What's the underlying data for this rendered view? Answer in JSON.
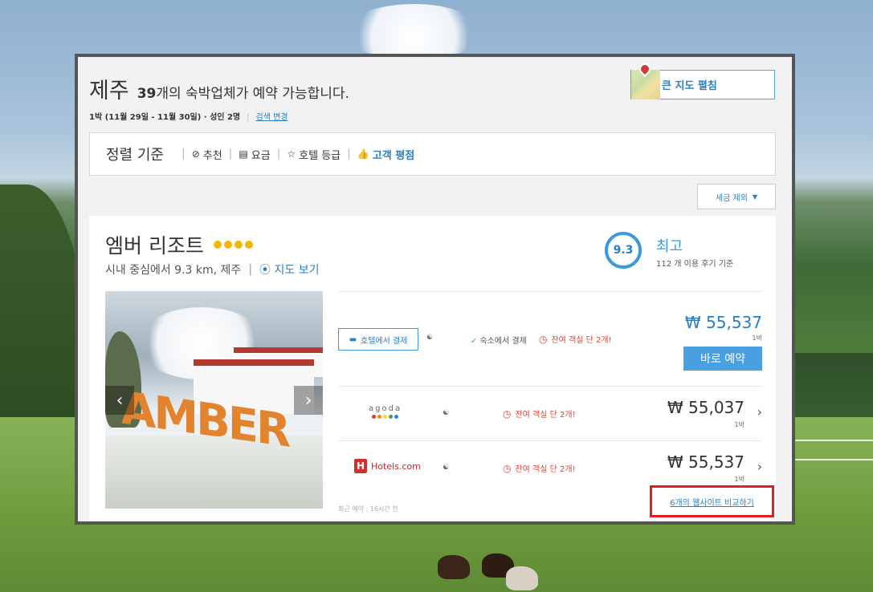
{
  "header": {
    "city": "제주",
    "count_number": "39",
    "count_suffix": "개의 숙박업체가 예약 가능합니다.",
    "search_summary": "1박 (11월 29일 - 11월 30일) · 성인 2명",
    "change_search": "검색 변경",
    "map_button": "큰 지도 펼침"
  },
  "sort": {
    "title": "정렬 기준",
    "items": [
      {
        "label": "추천",
        "icon": "check-circle-icon"
      },
      {
        "label": "요금",
        "icon": "money-icon"
      },
      {
        "label": "호텔 등급",
        "icon": "star-icon"
      },
      {
        "label": "고객 평점",
        "icon": "thumbs-up-icon",
        "active": true
      }
    ]
  },
  "tax_button": "세금 제외",
  "hotel": {
    "name": "엠버 리조트",
    "stars": 4,
    "location": "시내 중심에서 9.3 km, 제주",
    "map_link": "지도 보기",
    "rating_score": "9.3",
    "rating_word": "최고",
    "rating_count": "112 개 이용 후기 기준",
    "photo_sign": "AMBER",
    "offers": [
      {
        "provider": "호텔에서 결제",
        "payment": "숙소에서 결제",
        "scarcity": "잔여 객실 단 2개!",
        "price": "₩ 55,537",
        "per": "1박",
        "cta": "바로 예약"
      },
      {
        "provider": "agoda",
        "scarcity": "잔여 객실 단 2개!",
        "price": "₩ 55,037",
        "per": "1박"
      },
      {
        "provider": "Hotels.com",
        "scarcity": "잔여 객실 단 2개!",
        "price": "₩ 55,537",
        "per": "1박"
      }
    ],
    "recent_booking": "최근 예약 : 16시간 전",
    "compare_link": "6개의 웹사이트 비교하기"
  },
  "colors": {
    "accent": "#2a7fc2",
    "alert": "#e0433b",
    "highlight_box": "#e21d23",
    "star": "#f2b705"
  }
}
